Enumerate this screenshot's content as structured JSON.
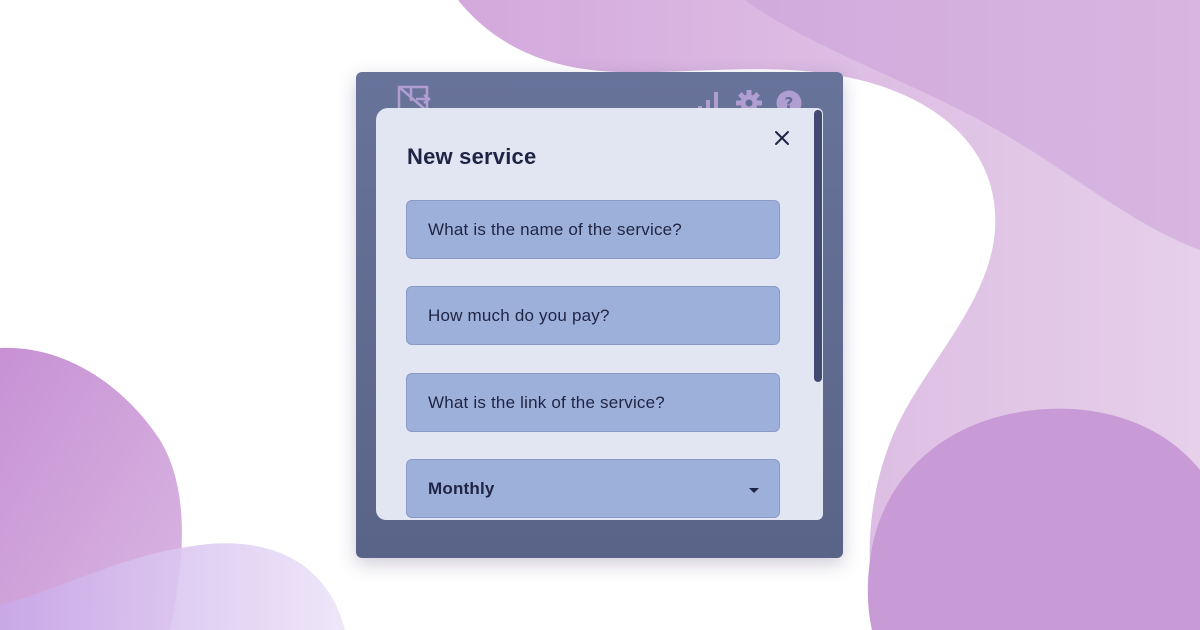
{
  "modal": {
    "title": "New service",
    "fields": [
      {
        "placeholder": "What is the name of the service?"
      },
      {
        "placeholder": "How much do you pay?"
      },
      {
        "placeholder": "What is the link of the service?"
      }
    ],
    "billing_select": {
      "value": "Monthly"
    }
  },
  "icons": {
    "logo": "logo-icon",
    "stats": "bar-chart-icon",
    "settings": "gear-icon",
    "help": "help-icon",
    "close": "close-icon",
    "dropdown": "caret-down-icon"
  },
  "colors": {
    "app_background": "#5f6a90",
    "modal_background": "#e1e6f2",
    "field_background": "#9db0d9",
    "text": "#1f2444",
    "blob_purple": "#c89ad6"
  }
}
